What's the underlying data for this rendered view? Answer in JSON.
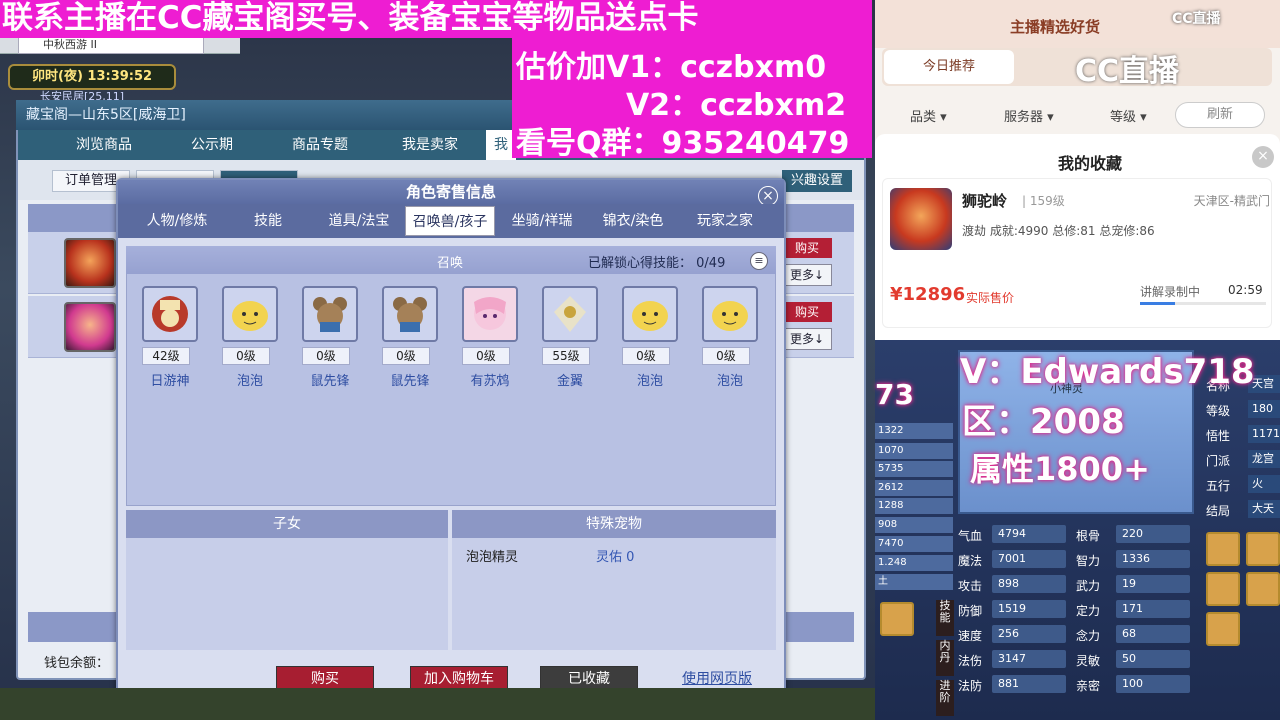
{
  "overlay": {
    "top_line": "联系主播在CC藏宝阁买号、装备宝宝等物品送点卡",
    "line1": "估价加V1：cczbxm0",
    "line2": "V2：cczbxm2",
    "line3": "看号Q群：935240479"
  },
  "game": {
    "tab_title": "中秋西游 II",
    "time": "卯时(夜) 13:39:52",
    "location": "长安民居[25,11]",
    "wallet_label": "钱包余额："
  },
  "cangbaoge": {
    "title": "藏宝阁—山东5区[威海卫]",
    "tabs": [
      "浏览商品",
      "公示期",
      "商品专题",
      "我是卖家",
      "我"
    ],
    "sub_buttons": [
      "订单管理",
      "",
      "",
      "",
      "",
      ""
    ],
    "settings_label": "兴趣设置",
    "buy_label": "购买",
    "more_label": "更多↓"
  },
  "dialog": {
    "title": "角色寄售信息",
    "close": "×",
    "tabs": [
      "人物/修炼",
      "技能",
      "道具/法宝",
      "召唤兽/孩子",
      "坐骑/祥瑞",
      "锦衣/染色",
      "玩家之家"
    ],
    "active_tab": "召唤兽/孩子",
    "summon_header": "召唤",
    "skill_unlock_label": "已解锁心得技能：",
    "skill_unlock_value": "0/49",
    "pets": [
      {
        "level": "42级",
        "name": "日游神"
      },
      {
        "level": "0级",
        "name": "泡泡"
      },
      {
        "level": "0级",
        "name": "鼠先锋"
      },
      {
        "level": "0级",
        "name": "鼠先锋"
      },
      {
        "level": "0级",
        "name": "有苏鸩"
      },
      {
        "level": "55级",
        "name": "金翼"
      },
      {
        "level": "0级",
        "name": "泡泡"
      },
      {
        "level": "0级",
        "name": "泡泡"
      }
    ],
    "children_header": "子女",
    "special_header": "特殊宠物",
    "special_name": "泡泡精灵",
    "special_value": "灵佑 0",
    "buttons": {
      "buy": "购买",
      "cart": "加入购物车",
      "collected": "已收藏"
    },
    "web_link": "使用网页版"
  },
  "shop": {
    "title": "主播精选好货",
    "active_tab": "今日推荐",
    "filters": [
      "品类 ▾",
      "服务器 ▾",
      "等级 ▾"
    ],
    "refresh": "刷新",
    "logo": "CC直播",
    "logo_small": "CC直播",
    "fav_title": "我的收藏",
    "fav_close": "×",
    "item": {
      "name": "狮驼岭",
      "level": "| 159级",
      "server": "天津区-精武门",
      "stats": "渡劫 成就:4990 总修:81 总宠修:86",
      "price": "¥12896",
      "price_note": "实际售价",
      "status": "讲解录制中",
      "timer": "02:59",
      "progress": 0.28
    }
  },
  "stats": {
    "overlay_v": "V：Edwards718",
    "overlay_zone": "区：2008",
    "overlay_attr": "属性1800+",
    "left_number": "73",
    "portrait_label": "小神灵",
    "left_values": [
      "1322",
      "1070",
      "5735",
      "2612",
      "1288",
      "908",
      "7470",
      "1.248",
      "土"
    ],
    "rows": [
      {
        "l1": "气血",
        "v1": "4794",
        "l2": "根骨",
        "v2": "220"
      },
      {
        "l1": "魔法",
        "v1": "7001",
        "l2": "智力",
        "v2": "1336"
      },
      {
        "l1": "攻击",
        "v1": "898",
        "l2": "武力",
        "v2": "19"
      },
      {
        "l1": "防御",
        "v1": "1519",
        "l2": "定力",
        "v2": "171"
      },
      {
        "l1": "速度",
        "v1": "256",
        "l2": "念力",
        "v2": "68"
      },
      {
        "l1": "法伤",
        "v1": "3147",
        "l2": "灵敏",
        "v2": "50"
      },
      {
        "l1": "法防",
        "v1": "881",
        "l2": "亲密",
        "v2": "100"
      }
    ],
    "right_rows": [
      {
        "label": "名称",
        "value": "天宫"
      },
      {
        "label": "等级",
        "value": "180"
      },
      {
        "label": "悟性",
        "value": "1171"
      },
      {
        "label": "门派",
        "value": "龙宫"
      },
      {
        "label": "五行",
        "value": "火"
      },
      {
        "label": "结局",
        "value": "大天"
      }
    ],
    "side_tabs": [
      "技能",
      "内丹",
      "进阶"
    ]
  },
  "colors": {
    "overlay_magenta": "#ee1dd2",
    "buy_red": "#b41f35",
    "price_red": "#e23a2e"
  }
}
